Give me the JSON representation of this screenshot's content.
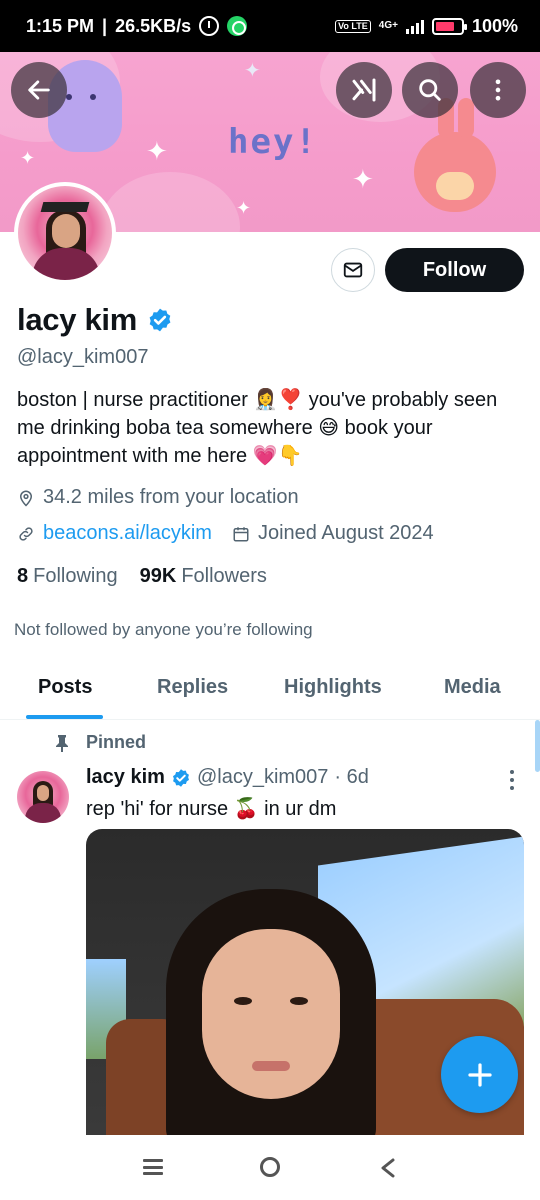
{
  "status_bar": {
    "time": "1:15 PM",
    "speed": "26.5KB/s",
    "network": "4G+",
    "volte": "Vo LTE",
    "battery": "100%"
  },
  "header": {
    "banner_text": "hey!",
    "icons": [
      "back-arrow-icon",
      "grok-icon",
      "search-icon",
      "more-vertical-icon"
    ]
  },
  "profile": {
    "name": "lacy kim",
    "handle": "@lacy_kim007",
    "bio": "boston | nurse practitioner 👩‍⚕️❣️ you've probably seen me drinking boba tea somewhere 😅 book your appointment with me here 💗👇",
    "location": "34.2 miles from your location",
    "link": "beacons.ai/lacykim",
    "joined": "Joined August 2024",
    "following_count": "8",
    "following_label": "Following",
    "followers_count": "99K",
    "followers_label": "Followers",
    "not_followed_text": "Not followed by anyone you’re following",
    "follow_label": "Follow"
  },
  "tabs": [
    {
      "label": "Posts",
      "active": true
    },
    {
      "label": "Replies",
      "active": false
    },
    {
      "label": "Highlights",
      "active": false
    },
    {
      "label": "Media",
      "active": false
    }
  ],
  "post": {
    "pinned_label": "Pinned",
    "author": "lacy kim",
    "handle": "@lacy_kim007",
    "time": "· 6d",
    "text": "rep 'hi' for  nurse 🍒 in ur dm"
  },
  "colors": {
    "accent": "#1d9bf0",
    "text": "#0f1419",
    "muted": "#536471",
    "banner": "#f59ccb"
  }
}
